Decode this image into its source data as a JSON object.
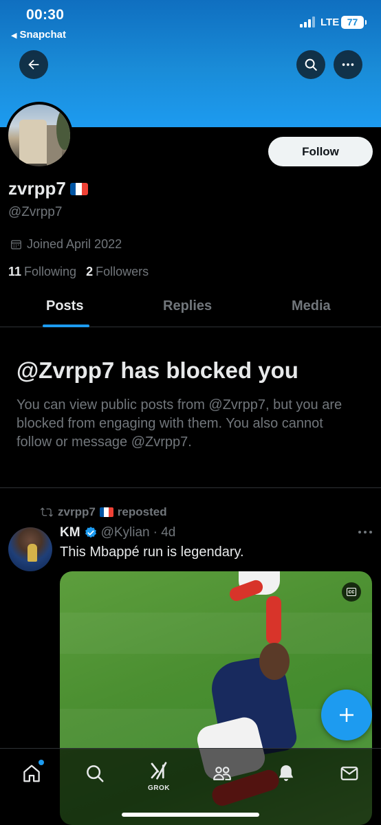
{
  "status_bar": {
    "time": "00:30",
    "back_app": "Snapchat",
    "network": "LTE",
    "battery": "77"
  },
  "profile": {
    "display_name": "zvrpp7",
    "handle": "@Zvrpp7",
    "joined": "Joined April 2022",
    "following_count": "11",
    "following_label": "Following",
    "followers_count": "2",
    "followers_label": "Followers",
    "follow_button": "Follow"
  },
  "tabs": [
    {
      "label": "Posts",
      "active": true
    },
    {
      "label": "Replies",
      "active": false
    },
    {
      "label": "Media",
      "active": false
    }
  ],
  "blocked": {
    "title": "@Zvrpp7 has blocked you",
    "body": "You can view public posts from @Zvrpp7, but you are blocked from engaging with them. You also cannot follow or message @Zvrpp7."
  },
  "post": {
    "repost_user": "zvrpp7",
    "repost_label": "reposted",
    "author_name": "KM",
    "author_handle": "@Kylian",
    "time": "· 4d",
    "text": "This Mbappé run is legendary.",
    "media_badge": "cc"
  },
  "bottom_nav": {
    "grok_label": "GROK"
  },
  "colors": {
    "accent": "#1d9bf0",
    "background": "#000000",
    "text_secondary": "#71767b"
  }
}
